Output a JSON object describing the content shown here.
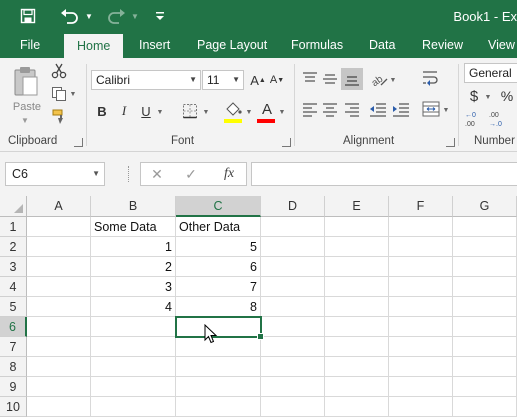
{
  "window": {
    "title": "Book1 - Ex"
  },
  "qat": {
    "save_icon": "save-icon",
    "undo_icon": "undo-icon",
    "redo_icon": "redo-icon",
    "customize_icon": "customize-qat-icon"
  },
  "tabs": [
    {
      "label": "File"
    },
    {
      "label": "Home",
      "active": true
    },
    {
      "label": "Insert"
    },
    {
      "label": "Page Layout"
    },
    {
      "label": "Formulas"
    },
    {
      "label": "Data"
    },
    {
      "label": "Review"
    },
    {
      "label": "View"
    }
  ],
  "ribbon": {
    "clipboard": {
      "label": "Clipboard",
      "paste_label": "Paste"
    },
    "font": {
      "label": "Font",
      "name": "Calibri",
      "size": "11",
      "highlight_color": "#ffff00",
      "font_color": "#ff0000"
    },
    "alignment": {
      "label": "Alignment"
    },
    "number": {
      "label": "Number",
      "format": "General",
      "currency_symbol": "$",
      "percent_symbol": "%"
    }
  },
  "formula_bar": {
    "name_box": "C6",
    "fx_label": "fx",
    "value": ""
  },
  "sheet": {
    "columns": [
      "A",
      "B",
      "C",
      "D",
      "E",
      "F",
      "G"
    ],
    "rows": [
      "1",
      "2",
      "3",
      "4",
      "5",
      "6",
      "7",
      "8",
      "9",
      "10"
    ],
    "cells": {
      "B1": "Some Data",
      "C1": "Other Data",
      "B2": "1",
      "C2": "5",
      "B3": "2",
      "C3": "6",
      "B4": "3",
      "C4": "7",
      "B5": "4",
      "C5": "8"
    },
    "active_cell": "C6"
  },
  "colors": {
    "accent": "#217346",
    "ribbon_bg": "#f3f3f3"
  }
}
